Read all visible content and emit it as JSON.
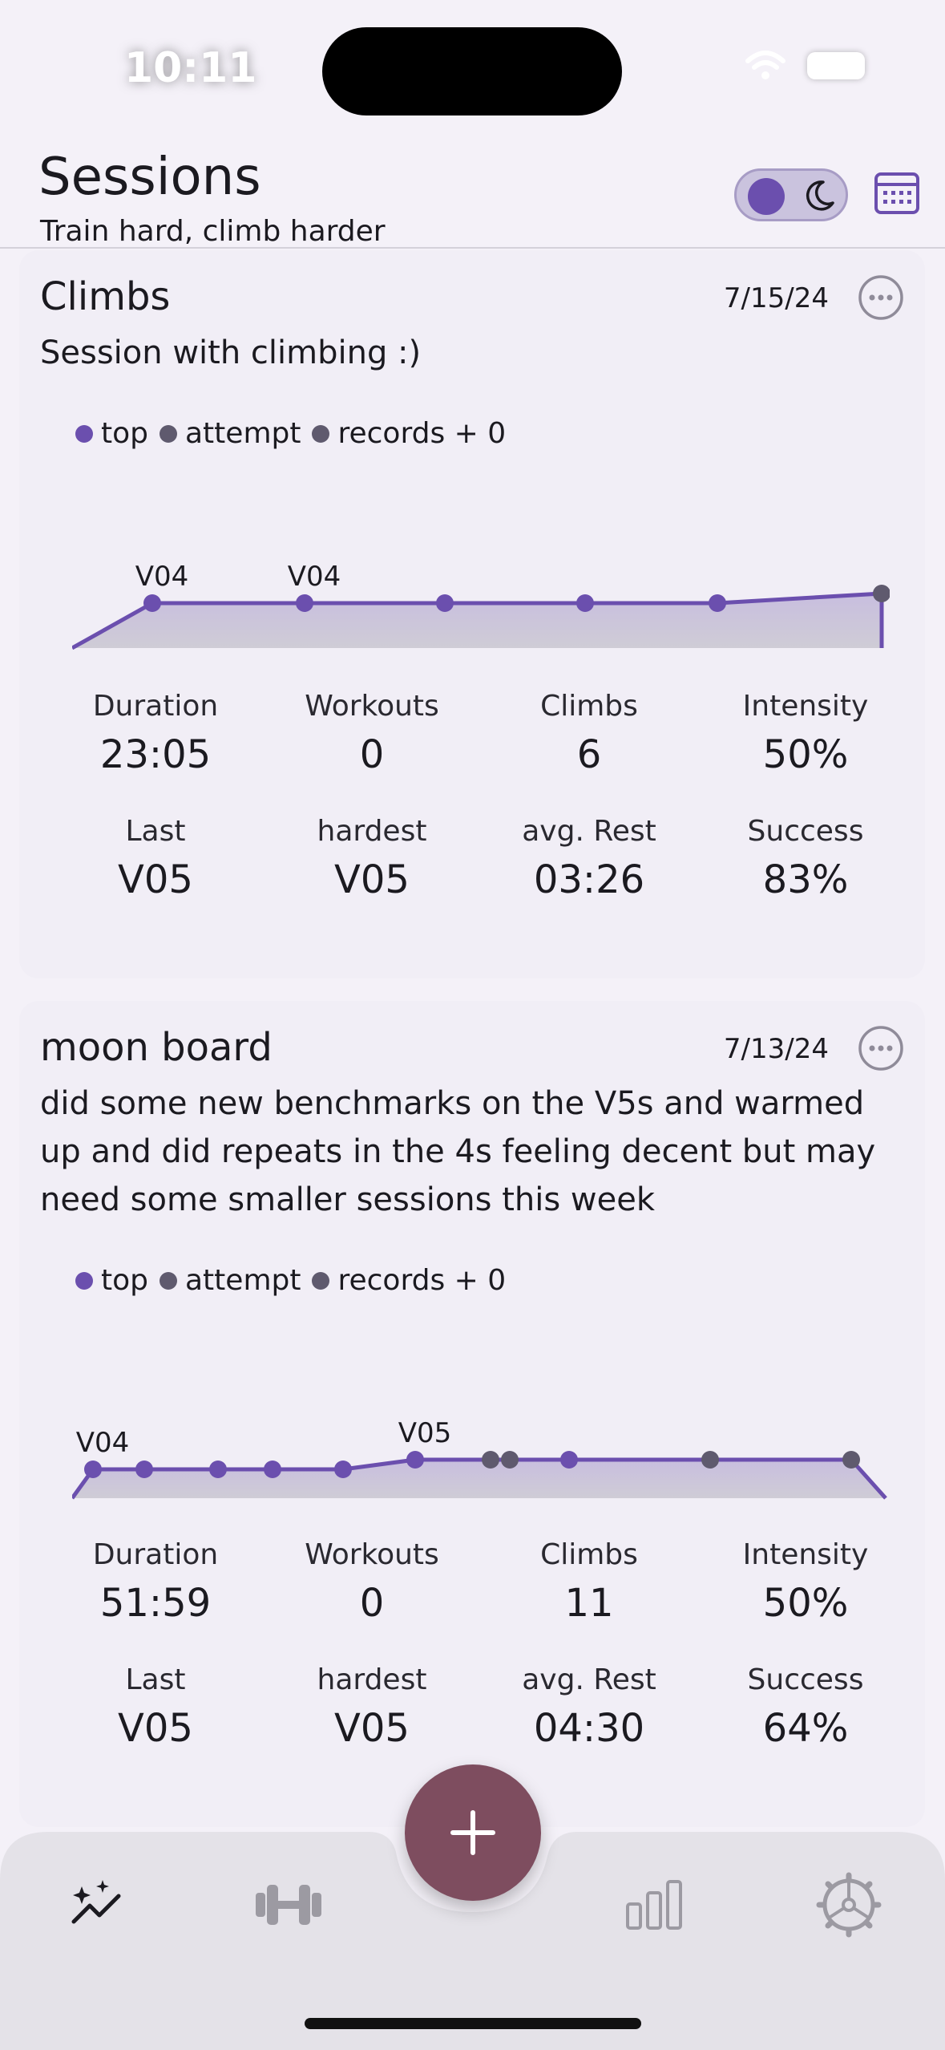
{
  "status": {
    "time": "10:11"
  },
  "header": {
    "title": "Sessions",
    "subtitle": "Train hard, climb harder"
  },
  "colors": {
    "accent": "#6b4fae",
    "attempt": "#5f5a6e",
    "fab": "#7e4d5f"
  },
  "legend": {
    "top": "top",
    "attempt": "attempt",
    "records": "records + 0"
  },
  "stat_labels": {
    "duration": "Duration",
    "workouts": "Workouts",
    "climbs": "Climbs",
    "intensity": "Intensity",
    "last": "Last",
    "hardest": "hardest",
    "avg_rest": "avg. Rest",
    "success": "Success"
  },
  "sessions": [
    {
      "title": "Climbs",
      "date": "7/15/24",
      "description": "Session with climbing :)",
      "stats": {
        "duration": "23:05",
        "workouts": "0",
        "climbs": "6",
        "intensity": "50%",
        "last": "V05",
        "hardest": "V05",
        "avg_rest": "03:26",
        "success": "83%"
      },
      "chart_data": {
        "type": "area",
        "points": [
          {
            "kind": "top",
            "label": "V04"
          },
          {
            "kind": "top",
            "label": "V04"
          },
          {
            "kind": "top",
            "label": ""
          },
          {
            "kind": "top",
            "label": ""
          },
          {
            "kind": "top",
            "label": ""
          },
          {
            "kind": "attempt",
            "label": ""
          }
        ]
      }
    },
    {
      "title": "moon board",
      "date": "7/13/24",
      "description": "did some new benchmarks on the V5s and warmed up and did repeats in the 4s feeling decent but may need some smaller sessions this week",
      "stats": {
        "duration": "51:59",
        "workouts": "0",
        "climbs": "11",
        "intensity": "50%",
        "last": "V05",
        "hardest": "V05",
        "avg_rest": "04:30",
        "success": "64%"
      },
      "chart_data": {
        "type": "area",
        "points": [
          {
            "kind": "top",
            "label": "V04"
          },
          {
            "kind": "top",
            "label": ""
          },
          {
            "kind": "top",
            "label": ""
          },
          {
            "kind": "top",
            "label": ""
          },
          {
            "kind": "top",
            "label": ""
          },
          {
            "kind": "top",
            "label": "V05"
          },
          {
            "kind": "attempt",
            "label": ""
          },
          {
            "kind": "attempt",
            "label": ""
          },
          {
            "kind": "top",
            "label": ""
          },
          {
            "kind": "attempt",
            "label": ""
          },
          {
            "kind": "attempt",
            "label": ""
          }
        ]
      }
    }
  ],
  "tabs": [
    {
      "icon": "sparkle-chart-icon"
    },
    {
      "icon": "dumbbell-icon"
    },
    {
      "icon": "add-icon"
    },
    {
      "icon": "bar-chart-icon"
    },
    {
      "icon": "settings-gear-icon"
    }
  ]
}
